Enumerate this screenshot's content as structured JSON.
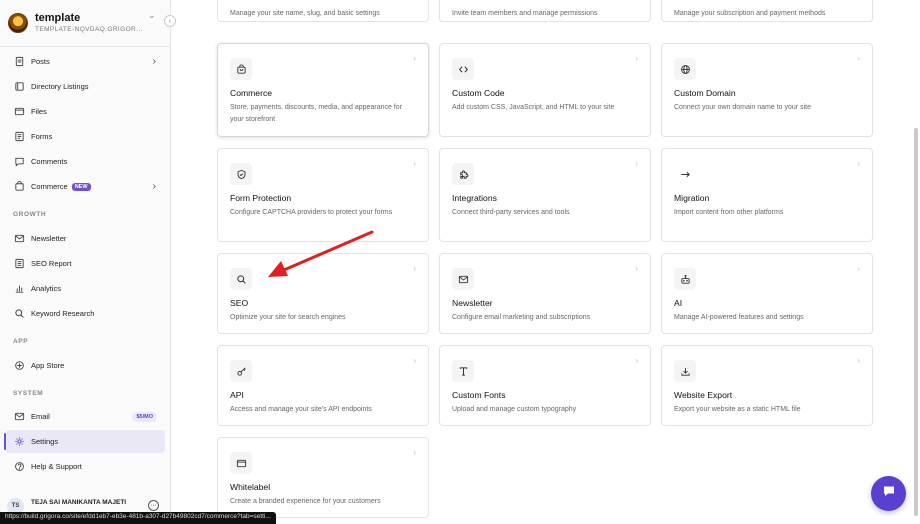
{
  "workspace": {
    "name": "template",
    "slug": "TEMPLATE-NQVDAQ.GRIGOR..."
  },
  "sidebar": {
    "items": [
      {
        "label": "Posts",
        "icon": "document-icon",
        "chevron": "›"
      },
      {
        "label": "Directory Listings",
        "icon": "book-icon"
      },
      {
        "label": "Files",
        "icon": "folder-icon"
      },
      {
        "label": "Forms",
        "icon": "form-icon"
      },
      {
        "label": "Comments",
        "icon": "comment-icon"
      },
      {
        "label": "Commerce",
        "icon": "cart-icon",
        "badge": "NEW",
        "chevron": "›"
      }
    ],
    "growth_label": "GROWTH",
    "growth_items": [
      {
        "label": "Newsletter",
        "icon": "mail-icon"
      },
      {
        "label": "SEO Report",
        "icon": "report-icon"
      },
      {
        "label": "Analytics",
        "icon": "chart-icon"
      },
      {
        "label": "Keyword Research",
        "icon": "search-icon"
      }
    ],
    "app_label": "APP",
    "app_items": [
      {
        "label": "App Store",
        "icon": "store-icon"
      }
    ],
    "system_label": "SYSTEM",
    "system_items": [
      {
        "label": "Email",
        "icon": "mail-icon",
        "badge": "$5/MO"
      },
      {
        "label": "Settings",
        "icon": "gear-icon",
        "active": true
      },
      {
        "label": "Help & Support",
        "icon": "help-icon"
      }
    ],
    "user": {
      "initials": "TS",
      "name": "TEJA SAI MANIKANTA MAJETI"
    }
  },
  "status_url": "https://build.grigora.co/site/efdd1eb7-eb3e-481b-a307-d27b49802cd7/commerce?tab=setti...",
  "top_partial": [
    {
      "desc": "Manage your site name, slug, and basic settings"
    },
    {
      "desc": "Invite team members and manage permissions"
    },
    {
      "desc": "Manage your subscription and payment methods"
    }
  ],
  "cards": [
    {
      "title": "Commerce",
      "desc": "Store, payments, discounts, media, and appearance for your storefront",
      "icon": "bag-icon"
    },
    {
      "title": "Custom Code",
      "desc": "Add custom CSS, JavaScript, and HTML to your site",
      "icon": "code-icon"
    },
    {
      "title": "Custom Domain",
      "desc": "Connect your own domain name to your site",
      "icon": "globe-icon"
    },
    {
      "title": "Form Protection",
      "desc": "Configure CAPTCHA providers to protect your forms",
      "icon": "shield-icon"
    },
    {
      "title": "Integrations",
      "desc": "Connect third-party services and tools",
      "icon": "puzzle-icon"
    },
    {
      "title": "Migration",
      "desc": "Import content from other platforms",
      "icon": "arrow-right-icon"
    },
    {
      "title": "SEO",
      "desc": "Optimize your site for search engines",
      "icon": "search-icon"
    },
    {
      "title": "Newsletter",
      "desc": "Configure email marketing and subscriptions",
      "icon": "mail-icon"
    },
    {
      "title": "AI",
      "desc": "Manage AI-powered features and settings",
      "icon": "robot-icon"
    },
    {
      "title": "API",
      "desc": "Access and manage your site's API endpoints",
      "icon": "key-icon"
    },
    {
      "title": "Custom Fonts",
      "desc": "Upload and manage custom typography",
      "icon": "type-icon"
    },
    {
      "title": "Website Export",
      "desc": "Export your website as a static HTML file",
      "icon": "download-icon"
    },
    {
      "title": "Whitelabel",
      "desc": "Create a branded experience for your customers",
      "icon": "browser-icon"
    }
  ],
  "colors": {
    "accent": "#6d4fd6",
    "annotation_arrow": "#e02020"
  }
}
